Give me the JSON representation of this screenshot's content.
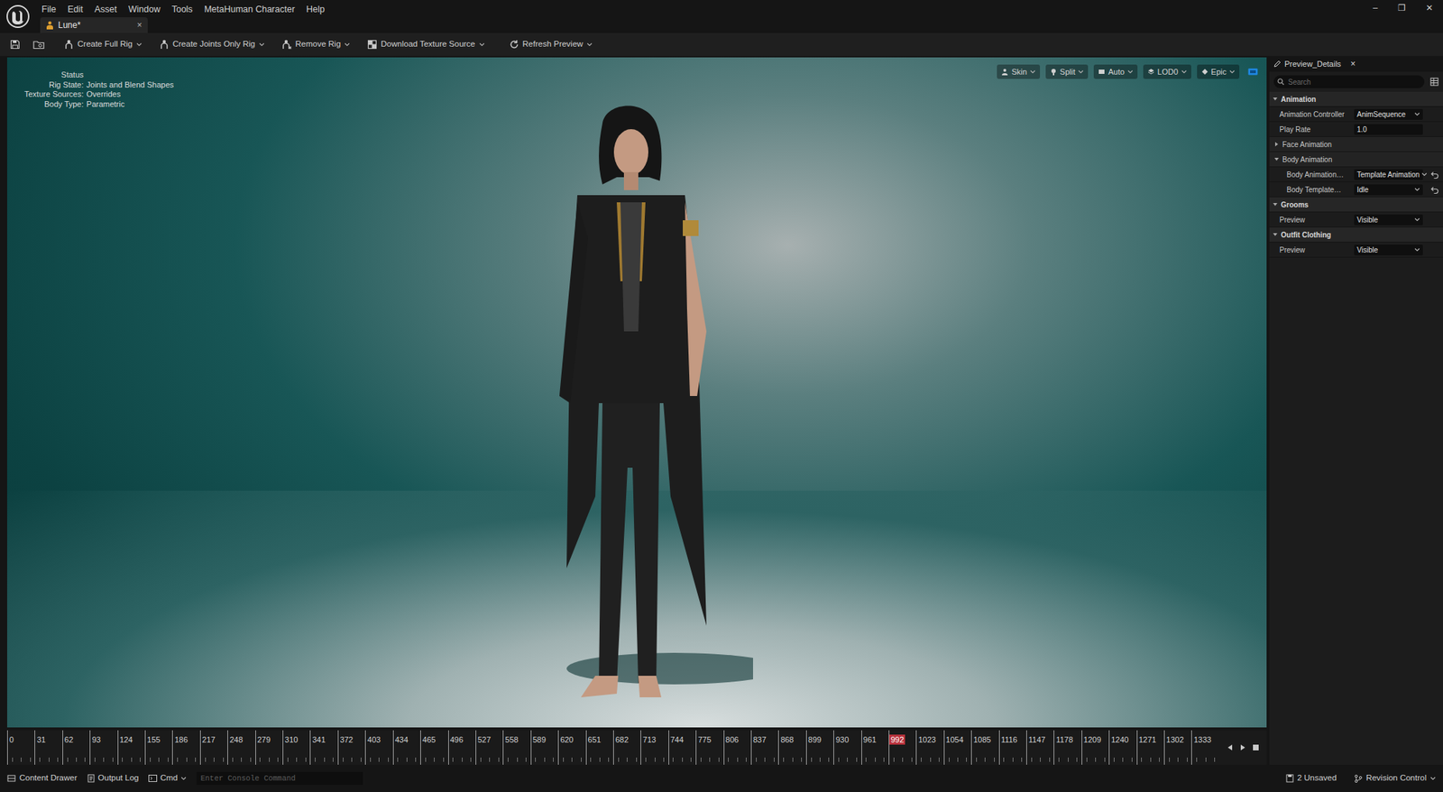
{
  "window": {
    "menu": [
      "File",
      "Edit",
      "Asset",
      "Window",
      "Tools",
      "MetaHuman Character",
      "Help"
    ],
    "controls": [
      "–",
      "❐",
      "✕"
    ]
  },
  "tabs": [
    {
      "label": "Lune*",
      "close": "×",
      "selected": true
    }
  ],
  "toolbar": [
    {
      "label": "Create Full Rig",
      "dropdown": false
    },
    {
      "label": "Create Joints Only Rig",
      "dropdown": false
    },
    {
      "label": "Remove Rig",
      "dropdown": false
    },
    {
      "label": "Download Texture Source",
      "dropdown": true
    },
    {
      "label": "Refresh Preview",
      "dropdown": false
    }
  ],
  "viewport": {
    "status": {
      "title": "Status",
      "lines": [
        {
          "label": "Rig State:",
          "value": "Joints and Blend Shapes"
        },
        {
          "label": "Texture Sources:",
          "value": "Overrides"
        },
        {
          "label": "Body Type:",
          "value": "Parametric"
        }
      ]
    },
    "options": [
      {
        "label": "Skin"
      },
      {
        "label": "Split"
      },
      {
        "label": "Auto"
      },
      {
        "label": "LOD0"
      },
      {
        "label": "Epic"
      }
    ]
  },
  "details": {
    "tab": "Preview_Details",
    "close": "×",
    "search": {
      "placeholder": "Search"
    },
    "sections": [
      {
        "title": "Animation",
        "expanded": true,
        "rows": [
          {
            "kind": "dropdown",
            "label": "Animation Controller",
            "value": "AnimSequence",
            "modified": false
          },
          {
            "kind": "number",
            "label": "Play Rate",
            "value": "1.0"
          },
          {
            "kind": "group",
            "label": "Face Animation",
            "expanded": false,
            "rows": []
          },
          {
            "kind": "group",
            "label": "Body Animation",
            "expanded": true,
            "rows": [
              {
                "kind": "dropdown",
                "label": "Body Animation…",
                "value": "Template Animation",
                "modified": true
              },
              {
                "kind": "dropdown",
                "label": "Body Template…",
                "value": "Idle",
                "modified": true
              }
            ]
          }
        ]
      },
      {
        "title": "Grooms",
        "expanded": true,
        "rows": [
          {
            "kind": "dropdown",
            "label": "Preview",
            "value": "Visible",
            "modified": false
          }
        ]
      },
      {
        "title": "Outfit Clothing",
        "expanded": true,
        "rows": [
          {
            "kind": "dropdown",
            "label": "Preview",
            "value": "Visible",
            "modified": false
          }
        ]
      }
    ]
  },
  "timeline": {
    "ticks": [
      {
        "label": "0",
        "selected": false
      },
      {
        "label": "31",
        "selected": false
      },
      {
        "label": "62",
        "selected": false
      },
      {
        "label": "93",
        "selected": false
      },
      {
        "label": "124",
        "selected": false
      },
      {
        "label": "155",
        "selected": false
      },
      {
        "label": "186",
        "selected": false
      },
      {
        "label": "217",
        "selected": false
      },
      {
        "label": "248",
        "selected": false
      },
      {
        "label": "279",
        "selected": false
      },
      {
        "label": "310",
        "selected": false
      },
      {
        "label": "341",
        "selected": false
      },
      {
        "label": "372",
        "selected": false
      },
      {
        "label": "403",
        "selected": false
      },
      {
        "label": "434",
        "selected": false
      },
      {
        "label": "465",
        "selected": false
      },
      {
        "label": "496",
        "selected": false
      },
      {
        "label": "527",
        "selected": false
      },
      {
        "label": "558",
        "selected": false
      },
      {
        "label": "589",
        "selected": false
      },
      {
        "label": "620",
        "selected": false
      },
      {
        "label": "651",
        "selected": false
      },
      {
        "label": "682",
        "selected": false
      },
      {
        "label": "713",
        "selected": false
      },
      {
        "label": "744",
        "selected": false
      },
      {
        "label": "775",
        "selected": false
      },
      {
        "label": "806",
        "selected": false
      },
      {
        "label": "837",
        "selected": false
      },
      {
        "label": "868",
        "selected": false
      },
      {
        "label": "899",
        "selected": false
      },
      {
        "label": "930",
        "selected": false
      },
      {
        "label": "961",
        "selected": false
      },
      {
        "label": "992",
        "selected": true
      },
      {
        "label": "1023",
        "selected": false
      },
      {
        "label": "1054",
        "selected": false
      },
      {
        "label": "1085",
        "selected": false
      },
      {
        "label": "1116",
        "selected": false
      },
      {
        "label": "1147",
        "selected": false
      },
      {
        "label": "1178",
        "selected": false
      },
      {
        "label": "1209",
        "selected": false
      },
      {
        "label": "1240",
        "selected": false
      },
      {
        "label": "1271",
        "selected": false
      },
      {
        "label": "1302",
        "selected": false
      },
      {
        "label": "1333",
        "selected": false
      }
    ]
  },
  "status_bar": {
    "content_drawer": "Content Drawer",
    "output_log": "Output Log",
    "cmd": "Cmd",
    "console": {
      "placeholder": "Enter Console Command"
    },
    "unsaved": "2 Unsaved",
    "revision": "Revision Control"
  }
}
